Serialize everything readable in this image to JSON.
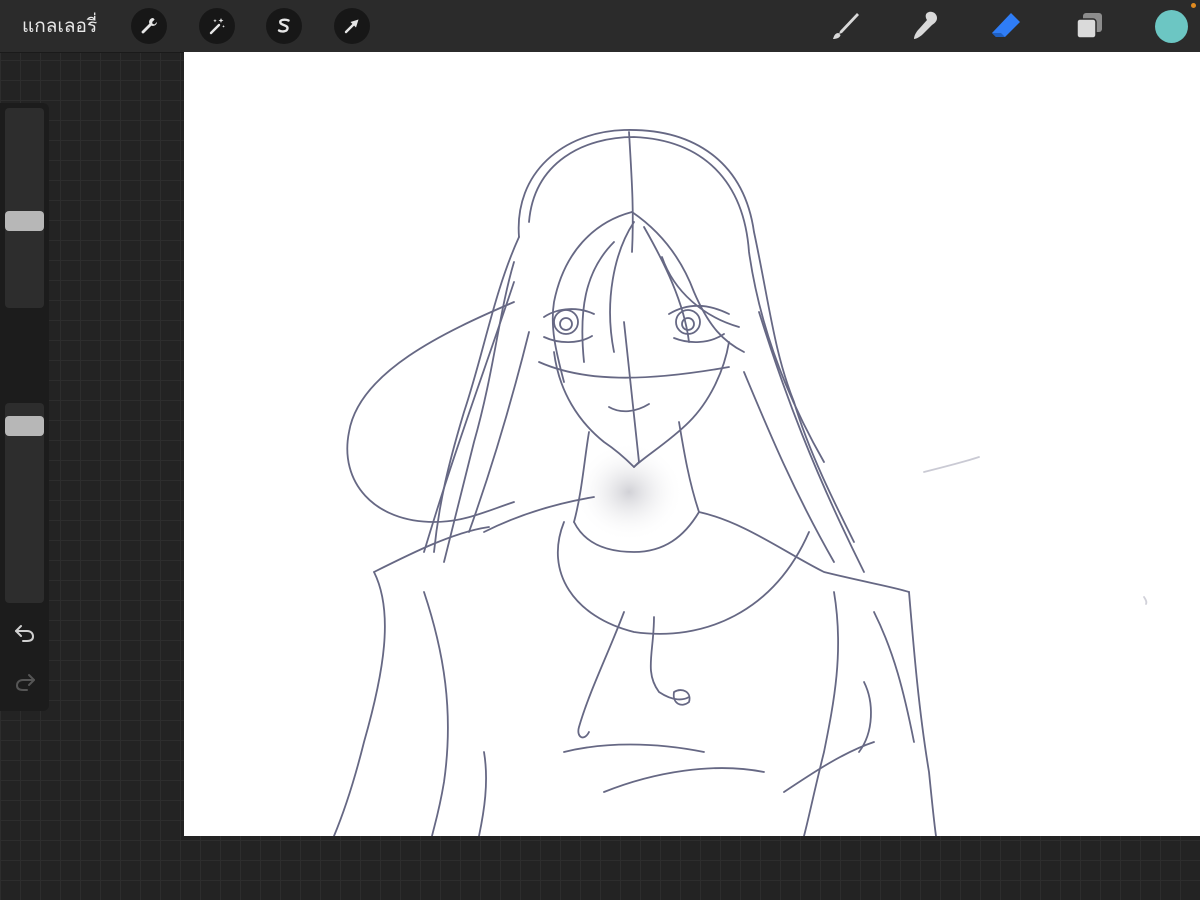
{
  "toolbar": {
    "gallery_label": "แกลเลอรี่",
    "left_tools": [
      {
        "name": "actions",
        "icon": "wrench-icon"
      },
      {
        "name": "adjustments",
        "icon": "magic-wand-icon"
      },
      {
        "name": "selection",
        "icon": "selection-s-icon"
      },
      {
        "name": "transform",
        "icon": "arrow-cursor-icon"
      }
    ],
    "right_tools": [
      {
        "name": "brush",
        "icon": "brush-icon",
        "active": false
      },
      {
        "name": "smudge",
        "icon": "smudge-finger-icon",
        "active": false
      },
      {
        "name": "eraser",
        "icon": "eraser-icon",
        "active": true
      },
      {
        "name": "layers",
        "icon": "layers-icon",
        "active": false
      }
    ],
    "current_color": "#6cc6c3",
    "active_tool_color": "#2f7df6"
  },
  "sidebar": {
    "brush_size_level": 0.43,
    "opacity_level": 0.93,
    "buttons": [
      "modify-button",
      "undo-button",
      "redo-button"
    ]
  },
  "canvas": {
    "background": "#ffffff",
    "stroke_color": "#4b4d6e"
  }
}
